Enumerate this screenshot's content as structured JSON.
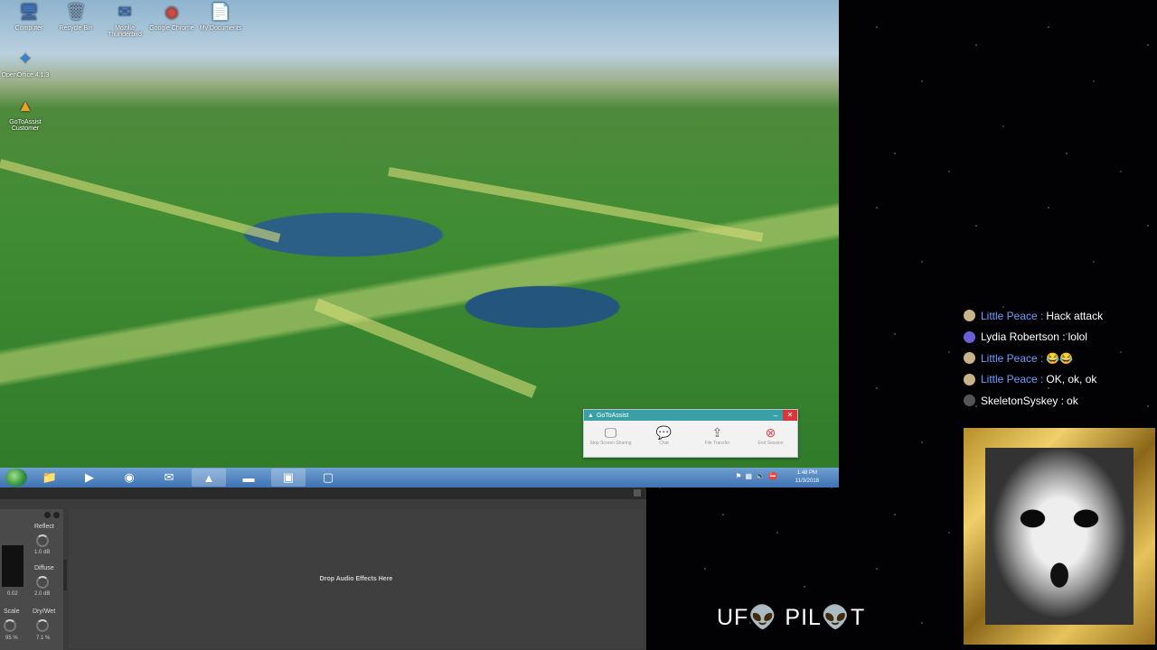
{
  "desktop": {
    "icons": [
      {
        "label": "Computer",
        "glyph": "🖥",
        "color": "#3a6fb5"
      },
      {
        "label": "Recycle Bin",
        "glyph": "🗑",
        "color": "#8aa9c9"
      },
      {
        "label": "Mozilla Thunderbird",
        "glyph": "✉",
        "color": "#2a62b5"
      },
      {
        "label": "Google Chrome",
        "glyph": "◉",
        "color": "#d9463c"
      },
      {
        "label": "My Documents",
        "glyph": "📄",
        "color": "#d7dce2"
      },
      {
        "label": "OpenOffice 4.1.3",
        "glyph": "✦",
        "color": "#2f84d4"
      },
      {
        "label": "GoToAssist Customer",
        "glyph": "▲",
        "color": "#f0a024"
      }
    ]
  },
  "taskbar": {
    "items": [
      {
        "name": "explorer",
        "glyph": "📁",
        "active": false
      },
      {
        "name": "media-player",
        "glyph": "▶",
        "active": false
      },
      {
        "name": "chrome",
        "glyph": "◉",
        "active": false
      },
      {
        "name": "thunderbird",
        "glyph": "✉",
        "active": false
      },
      {
        "name": "gotoassist",
        "glyph": "▲",
        "active": true
      },
      {
        "name": "terminal",
        "glyph": "▬",
        "active": false
      },
      {
        "name": "remote-desktop",
        "glyph": "▣",
        "active": true
      },
      {
        "name": "window",
        "glyph": "▢",
        "active": false
      }
    ],
    "time": "1:48 PM",
    "date": "11/3/2018"
  },
  "gotoassist": {
    "title": "GoToAssist",
    "tools": [
      {
        "label": "Stop Screen Sharing",
        "glyph": "🖵"
      },
      {
        "label": "Chat",
        "glyph": "💬"
      },
      {
        "label": "File Transfer",
        "glyph": "⇪"
      },
      {
        "label": "End Session",
        "glyph": "⊗"
      }
    ]
  },
  "audio": {
    "drop_text": "Drop Audio Effects Here",
    "reflect_label": "Reflect",
    "reflect_value": "1.0 dB",
    "diffuse_label": "Diffuse",
    "diffuse_value": "2.0 dB",
    "meter_value": "0.02",
    "scale_label": "Scale",
    "scale_value": "95 %",
    "drywet_label": "Dry/Wet",
    "drywet_value": "7.1 %"
  },
  "chat": [
    {
      "name": "Little Peace :",
      "message": "Hack attack",
      "name_color": "#6f9cff",
      "avatar_color": "#c9b48a"
    },
    {
      "name": "Lydia Robertson :",
      "message": "lolol",
      "name_color": "#ffffff",
      "avatar_color": "#6b5fd6"
    },
    {
      "name": "Little Peace :",
      "message": "😂😂",
      "name_color": "#6f9cff",
      "avatar_color": "#c9b48a"
    },
    {
      "name": "Little Peace :",
      "message": "OK, ok, ok",
      "name_color": "#6f9cff",
      "avatar_color": "#c9b48a"
    },
    {
      "name": "SkeletonSyskey :",
      "message": "ok",
      "name_color": "#ffffff",
      "avatar_color": "#555555"
    }
  ],
  "brand": {
    "logo_text": "UF👽 PIL👽T"
  }
}
